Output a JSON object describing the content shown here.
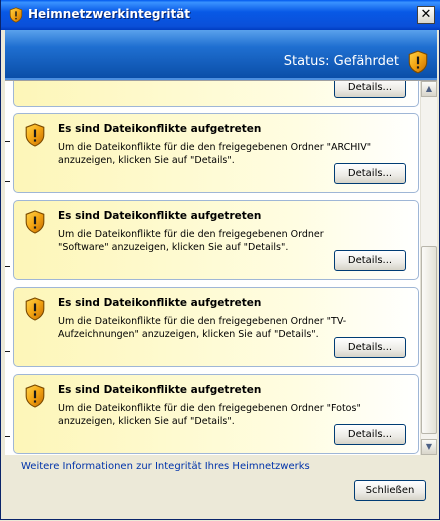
{
  "window": {
    "title": "Heimnetzwerkintegrität",
    "close_glyph": "✕"
  },
  "header": {
    "status": "Status: Gefährdet",
    "status_icon": "warning-shield-icon"
  },
  "top_partial_card": {
    "button_label": "Details..."
  },
  "conflicts": [
    {
      "title": "Es sind Dateikonflikte aufgetreten",
      "description": "Um die Dateikonflikte für die den freigegebenen Ordner \"ARCHIV\" anzuzeigen, klicken Sie auf \"Details\".",
      "button_label": "Details..."
    },
    {
      "title": "Es sind Dateikonflikte aufgetreten",
      "description": "Um die Dateikonflikte für die den freigegebenen Ordner \"Software\" anzuzeigen, klicken Sie auf \"Details\".",
      "button_label": "Details..."
    },
    {
      "title": "Es sind Dateikonflikte aufgetreten",
      "description": "Um die Dateikonflikte für die den freigegebenen Ordner \"TV-Aufzeichnungen\" anzuzeigen, klicken Sie auf \"Details\".",
      "button_label": "Details..."
    },
    {
      "title": "Es sind Dateikonflikte aufgetreten",
      "description": "Um die Dateikonflikte für die den freigegebenen Ordner \"Fotos\" anzuzeigen, klicken Sie auf \"Details\".",
      "button_label": "Details..."
    }
  ],
  "scrollbar": {
    "up_glyph": "▲",
    "down_glyph": "▼"
  },
  "footer": {
    "more_info_link": "Weitere Informationen zur Integrität Ihres Heimnetzwerks",
    "close_button": "Schließen"
  },
  "colors": {
    "card_fill": "#fdf6b8",
    "header_blue": "#1f6fd1",
    "link_blue": "#0033aa"
  }
}
